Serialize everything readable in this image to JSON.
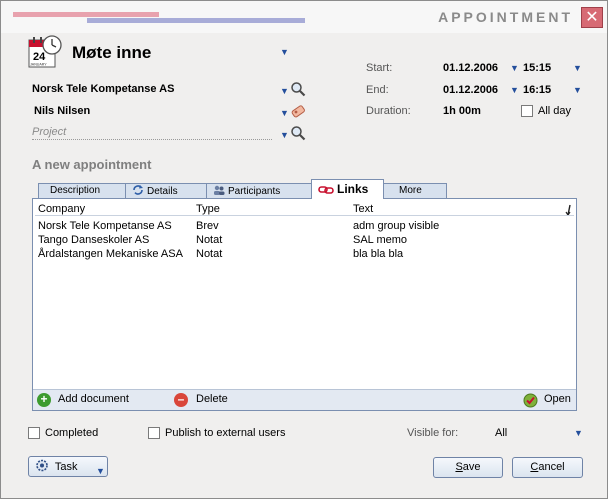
{
  "window": {
    "title": "APPOINTMENT",
    "close_glyph": "✕"
  },
  "calendar_icon": {
    "day": "24",
    "month": "JANUARY"
  },
  "header": {
    "subject": "Møte inne",
    "company": "Norsk Tele Kompetanse AS",
    "contact": "Nils Nilsen",
    "project_placeholder": "Project"
  },
  "time": {
    "start_label": "Start:",
    "start_date": "01.12.2006",
    "start_time": "15:15",
    "end_label": "End:",
    "end_date": "01.12.2006",
    "end_time": "16:15",
    "duration_label": "Duration:",
    "duration_value": "1h 00m",
    "allday_label": "All day"
  },
  "section_heading": "A new appointment",
  "tabs": [
    {
      "label": "Description"
    },
    {
      "label": "Details"
    },
    {
      "label": "Participants"
    },
    {
      "label": "Links"
    },
    {
      "label": "More"
    }
  ],
  "links_table": {
    "columns": [
      "Company",
      "Type",
      "Text"
    ],
    "rows": [
      {
        "company": "Norsk Tele Kompetanse AS",
        "type": "Brev",
        "text": "adm group visible"
      },
      {
        "company": "Tango Danseskoler AS",
        "type": "Notat",
        "text": "SAL memo"
      },
      {
        "company": "Årdalstangen Mekaniske ASA",
        "type": "Notat",
        "text": "bla bla bla"
      }
    ]
  },
  "panel_actions": {
    "add_document": "Add document",
    "delete": "Delete",
    "open": "Open"
  },
  "options": {
    "completed_label": "Completed",
    "publish_label": "Publish to external users",
    "visible_for_label": "Visible for:",
    "visible_for_value": "All"
  },
  "buttons": {
    "task": "Task",
    "save": "Save",
    "cancel": "Cancel"
  },
  "colors": {
    "accent_blue": "#244f9c",
    "title_stripe_pink": "#e8a2ae",
    "title_stripe_blue": "#a8acd8",
    "close_red": "#d76a74",
    "add_green": "#3d9b2f",
    "delete_red": "#d9463a"
  }
}
